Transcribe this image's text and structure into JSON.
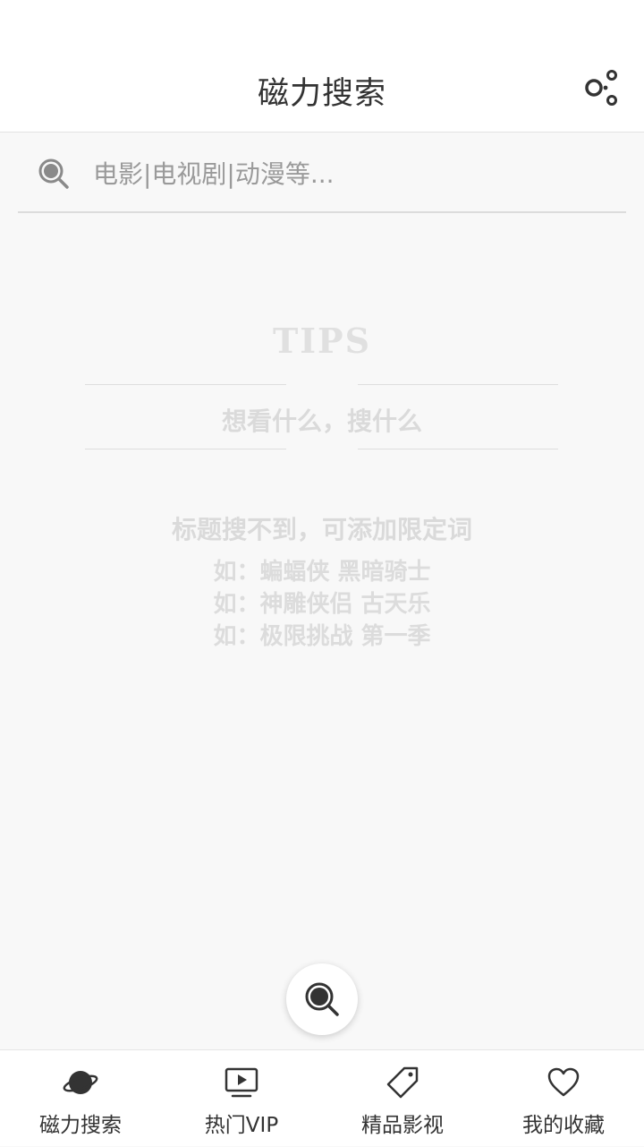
{
  "header": {
    "title": "磁力搜索",
    "share_icon": "share-icon"
  },
  "search": {
    "placeholder": "电影|电视剧|动漫等...",
    "value": "",
    "icon": "search-icon"
  },
  "tips": {
    "title": "TIPS",
    "line1": "想看什么，搜什么",
    "line2": "标题搜不到，可添加限定词",
    "examples": [
      "如：蝙蝠侠 黑暗骑士",
      "如：神雕侠侣 古天乐",
      "如：极限挑战 第一季"
    ]
  },
  "fab": {
    "icon": "search-icon"
  },
  "bottom_nav": {
    "items": [
      {
        "label": "磁力搜索",
        "icon": "planet-icon",
        "active": true
      },
      {
        "label": "热门VIP",
        "icon": "tv-play-icon"
      },
      {
        "label": "精品影视",
        "icon": "tag-icon"
      },
      {
        "label": "我的收藏",
        "icon": "heart-icon"
      }
    ]
  },
  "colors": {
    "background": "#f8f8f8",
    "bar_background": "#ffffff",
    "text": "#333333",
    "placeholder": "#9a9a9a",
    "tips_text": "#dadada"
  }
}
